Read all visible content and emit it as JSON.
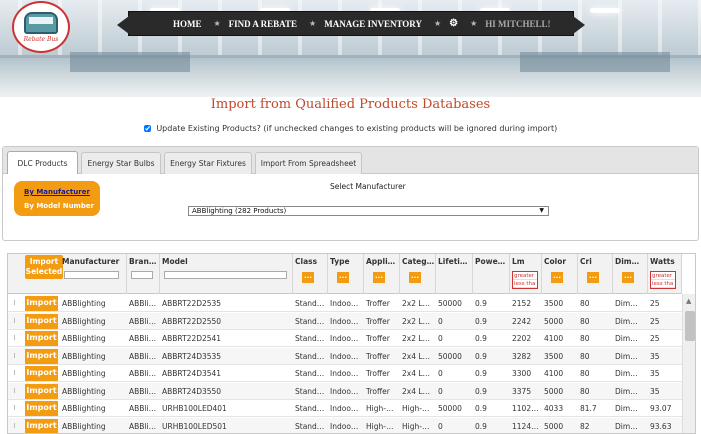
{
  "logo": {
    "text": "Rebate Bus"
  },
  "nav": {
    "items": [
      "HOME",
      "FIND A REBATE",
      "MANAGE INVENTORY",
      "HI MITCHELL!"
    ],
    "star": "★",
    "gear": "⚙"
  },
  "page_title": "Import from Qualified Products Databases",
  "update_checkbox": {
    "checked": true,
    "label": "Update Existing Products? (if unchecked changes to existing products will be ignored during import)"
  },
  "tabs": [
    "DLC Products",
    "Energy Star Bulbs",
    "Energy Star Fixtures",
    "Import From Spreadsheet"
  ],
  "active_tab": "DLC Products",
  "search_by": {
    "manufacturer": "By Manufacturer",
    "model": "By Model Number"
  },
  "select_manufacturer": {
    "label": "Select Manufacturer",
    "value": "ABBlighting (282 Products)"
  },
  "grid": {
    "import_selected_label": "Import Selected",
    "columns": [
      "Manufacturer",
      "Bran…",
      "Model",
      "Class",
      "Type",
      "Appli…",
      "Categ…",
      "Lifeti…",
      "Powe…",
      "Lm",
      "Color",
      "Cri",
      "Dim…",
      "Watts"
    ],
    "filter_button": "...",
    "lm_filter": [
      "greater",
      "less tha"
    ],
    "watts_filter": [
      "greater",
      "less tha"
    ],
    "import_label": "Import",
    "rows": [
      [
        "ABBlighting",
        "ABBli…",
        "ABBRT22D2535",
        "Stand…",
        "Indoo…",
        "Troffer",
        "2x2 L…",
        "50000",
        "0.9",
        "2152",
        "3500",
        "80",
        "Dim…",
        "25"
      ],
      [
        "ABBlighting",
        "ABBli…",
        "ABBRT22D2550",
        "Stand…",
        "Indoo…",
        "Troffer",
        "2x2 L…",
        "0",
        "0.9",
        "2242",
        "5000",
        "80",
        "Dim…",
        "25"
      ],
      [
        "ABBlighting",
        "ABBli…",
        "ABBRT22D2541",
        "Stand…",
        "Indoo…",
        "Troffer",
        "2x2 L…",
        "0",
        "0.9",
        "2202",
        "4100",
        "80",
        "Dim…",
        "25"
      ],
      [
        "ABBlighting",
        "ABBli…",
        "ABBRT24D3535",
        "Stand…",
        "Indoo…",
        "Troffer",
        "2x4 L…",
        "50000",
        "0.9",
        "3282",
        "3500",
        "80",
        "Dim…",
        "35"
      ],
      [
        "ABBlighting",
        "ABBli…",
        "ABBRT24D3541",
        "Stand…",
        "Indoo…",
        "Troffer",
        "2x4 L…",
        "0",
        "0.9",
        "3300",
        "4100",
        "80",
        "Dim…",
        "35"
      ],
      [
        "ABBlighting",
        "ABBli…",
        "ABBRT24D3550",
        "Stand…",
        "Indoo…",
        "Troffer",
        "2x4 L…",
        "0",
        "0.9",
        "3375",
        "5000",
        "80",
        "Dim…",
        "35"
      ],
      [
        "ABBlighting",
        "ABBli…",
        "URHB100LED401",
        "Stand…",
        "Indoo…",
        "High-…",
        "High-…",
        "50000",
        "0.9",
        "1102…",
        "4033",
        "81.7",
        "Dim…",
        "93.07"
      ],
      [
        "ABBlighting",
        "ABBli…",
        "URHB100LED501",
        "Stand…",
        "Indoo…",
        "High-…",
        "High-…",
        "0",
        "0.9",
        "1124…",
        "5000",
        "82",
        "Dim…",
        "93.63"
      ]
    ]
  },
  "colors": {
    "accent": "#f39c12",
    "title": "#c0492b",
    "nav": "#2a2a2a"
  }
}
